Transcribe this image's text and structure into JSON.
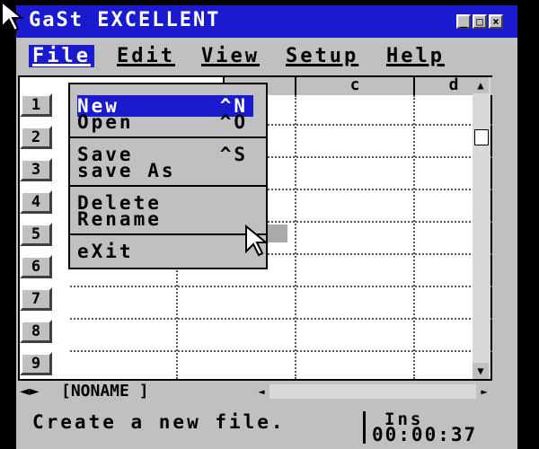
{
  "window": {
    "title": "GaSt EXCELLENT"
  },
  "menubar": [
    {
      "label": "File"
    },
    {
      "label": "Edit"
    },
    {
      "label": "View"
    },
    {
      "label": "Setup"
    },
    {
      "label": "Help"
    }
  ],
  "sheet": {
    "columns": [
      "",
      "c",
      "d"
    ],
    "rows": [
      "1",
      "2",
      "3",
      "4",
      "5",
      "6",
      "7",
      "8",
      "9"
    ],
    "filename": "[NONAME    ]"
  },
  "file_menu": {
    "items": [
      {
        "label": "New",
        "shortcut": "^N"
      },
      {
        "label": "Open",
        "shortcut": "^O"
      },
      {
        "label": "Save",
        "shortcut": "^S"
      },
      {
        "label": "save As",
        "shortcut": ""
      },
      {
        "label": "Delete",
        "shortcut": ""
      },
      {
        "label": "Rename",
        "shortcut": ""
      },
      {
        "label": "eXit",
        "shortcut": ""
      }
    ]
  },
  "status": {
    "message": "Create a new file.",
    "mode": "Ins",
    "time": "00:00:37"
  }
}
